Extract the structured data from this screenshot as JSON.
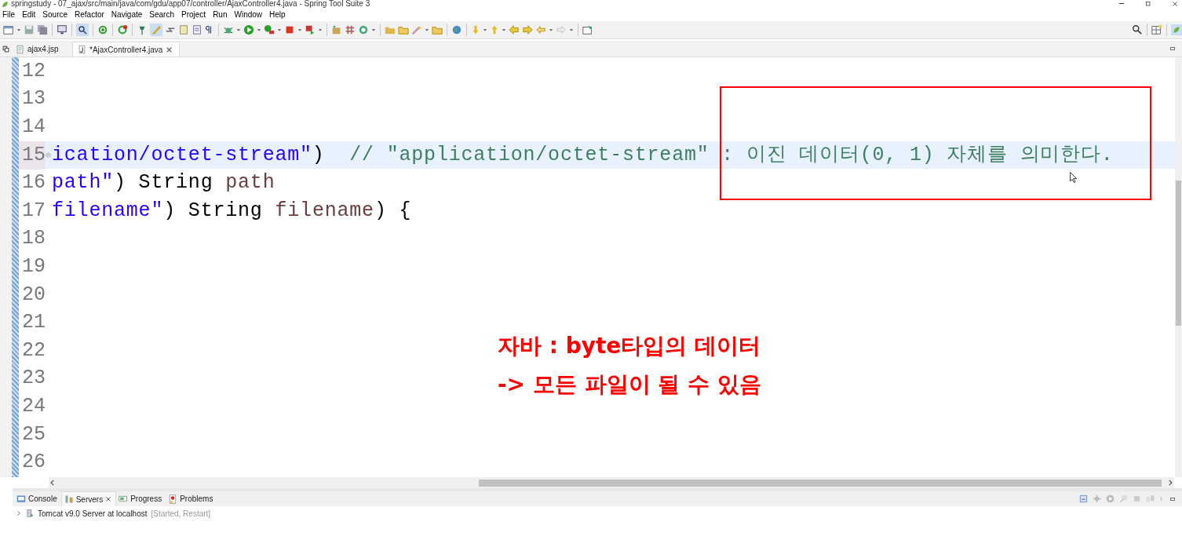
{
  "window": {
    "title": "springstudy - 07_ajax/src/main/java/com/gdu/app07/controller/AjaxController4.java - Spring Tool Suite 3"
  },
  "menu": [
    "File",
    "Edit",
    "Source",
    "Refactor",
    "Navigate",
    "Search",
    "Project",
    "Run",
    "Window",
    "Help"
  ],
  "editor_tabs": [
    {
      "label": "ajax4.jsp",
      "selected": false,
      "kind": "jsp"
    },
    {
      "label": "*AjaxController4.java",
      "selected": true,
      "kind": "java"
    }
  ],
  "editor": {
    "lines": [
      {
        "number": "12",
        "current": false,
        "foldable": false
      },
      {
        "number": "13",
        "current": false,
        "foldable": false
      },
      {
        "number": "14",
        "current": false,
        "foldable": false
      },
      {
        "number": "15",
        "current": true,
        "foldable": true,
        "tokens": [
          {
            "text": "ication/octet-stream\"",
            "kind": "string"
          },
          {
            "text": ")  ",
            "kind": "plain"
          },
          {
            "text": "// \"application/octet-stream\" : 이진 데이터(0, 1) 자체를 의미한다.",
            "kind": "comment"
          }
        ]
      },
      {
        "number": "16",
        "current": false,
        "foldable": false,
        "tokens": [
          {
            "text": "path\"",
            "kind": "string"
          },
          {
            "text": ") String ",
            "kind": "plain"
          },
          {
            "text": "path",
            "kind": "variable"
          }
        ]
      },
      {
        "number": "17",
        "current": false,
        "foldable": false,
        "tokens": [
          {
            "text": "filename\"",
            "kind": "string"
          },
          {
            "text": ") String ",
            "kind": "plain"
          },
          {
            "text": "filename",
            "kind": "variable"
          },
          {
            "text": ") {",
            "kind": "plain"
          }
        ]
      },
      {
        "number": "18",
        "current": false,
        "foldable": false
      },
      {
        "number": "19",
        "current": false,
        "foldable": false
      },
      {
        "number": "20",
        "current": false,
        "foldable": false
      },
      {
        "number": "21",
        "current": false,
        "foldable": false
      },
      {
        "number": "22",
        "current": false,
        "foldable": false
      },
      {
        "number": "23",
        "current": false,
        "foldable": false
      },
      {
        "number": "24",
        "current": false,
        "foldable": false
      },
      {
        "number": "25",
        "current": false,
        "foldable": false
      },
      {
        "number": "26",
        "current": false,
        "foldable": false
      }
    ]
  },
  "annotation": {
    "lines": [
      "자바 : byte타입의 데이터",
      "-> 모든 파일이 될 수 있음"
    ]
  },
  "bottom_tabs": [
    {
      "label": "Console",
      "selected": false,
      "kind": "console"
    },
    {
      "label": "Servers",
      "selected": true,
      "kind": "servers"
    },
    {
      "label": "Progress",
      "selected": false,
      "kind": "progress"
    },
    {
      "label": "Problems",
      "selected": false,
      "kind": "problems"
    }
  ],
  "servers": [
    {
      "name": "Tomcat v9.0 Server at localhost",
      "status": "[Started, Restart]",
      "expanded": false
    }
  ]
}
